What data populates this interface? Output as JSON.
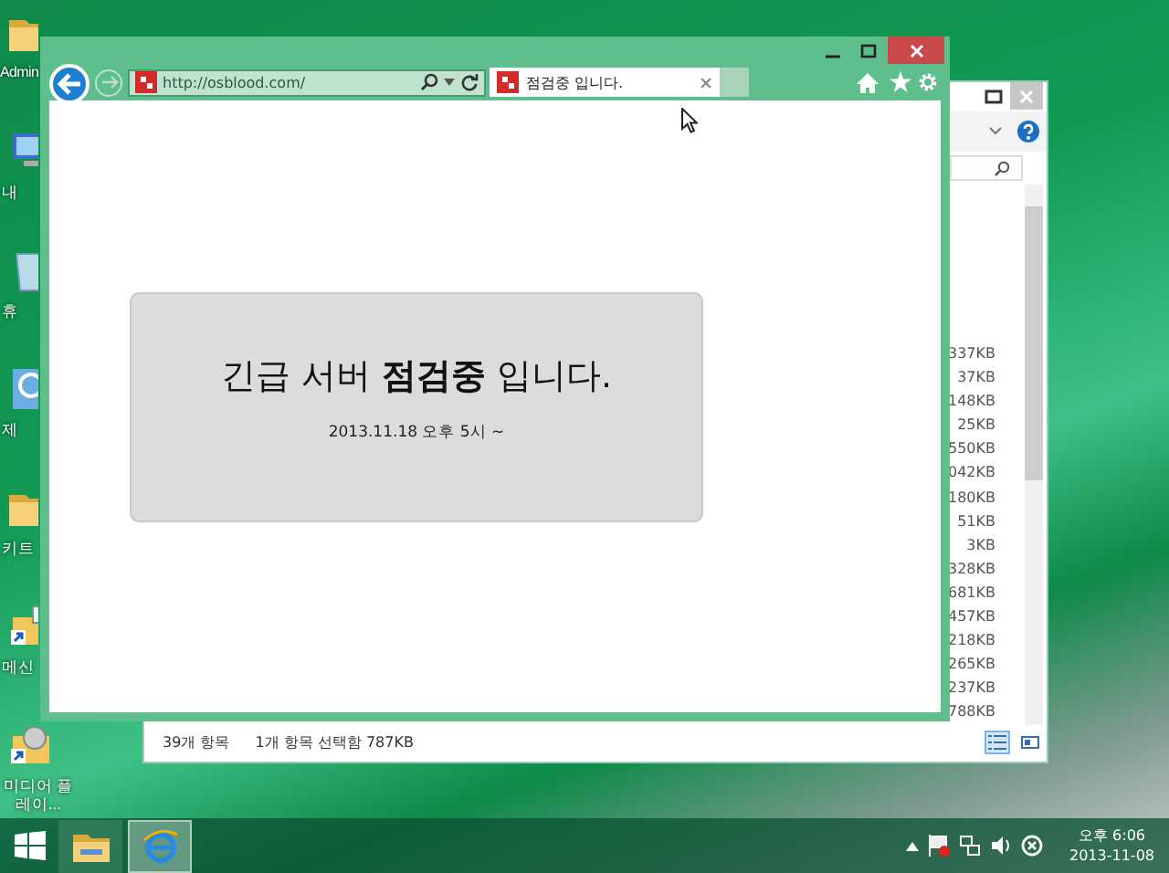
{
  "desktop": {
    "icons": [
      {
        "kind": "folder",
        "label": "Admin"
      },
      {
        "kind": "computer",
        "label": "내"
      },
      {
        "kind": "bin",
        "label": "휴"
      },
      {
        "kind": "panel",
        "label": "제"
      },
      {
        "kind": "folder",
        "label": "키트"
      },
      {
        "kind": "shortcut",
        "label": "메신"
      },
      {
        "kind": "media",
        "label": "미디어 플레이..."
      }
    ]
  },
  "explorer": {
    "sizes": [
      "337KB",
      "37KB",
      "148KB",
      "25KB",
      "550KB",
      "042KB",
      "180KB",
      "51KB",
      "3KB",
      "328KB",
      "681KB",
      "457KB",
      "218KB",
      "265KB",
      "237KB",
      "788KB"
    ],
    "status": {
      "item_count": "39개 항목",
      "selection": "1개 항목 선택함 787KB"
    },
    "view_buttons": [
      {
        "kind": "details",
        "selected": true
      },
      {
        "kind": "tiles",
        "selected": false
      }
    ]
  },
  "browser": {
    "address": "http://osblood.com/",
    "tab_title": "점검중 입니다.",
    "notice": {
      "heading": "긴급 서버 **점검중** 입니다.",
      "date": "2013.11.18 오후 5시 ~"
    }
  },
  "taskbar": {
    "apps": [
      {
        "kind": "explorer",
        "selected": false
      },
      {
        "kind": "browser",
        "selected": true
      }
    ],
    "clock": {
      "time": "오후 6:06",
      "date": "2013-11-08"
    }
  }
}
